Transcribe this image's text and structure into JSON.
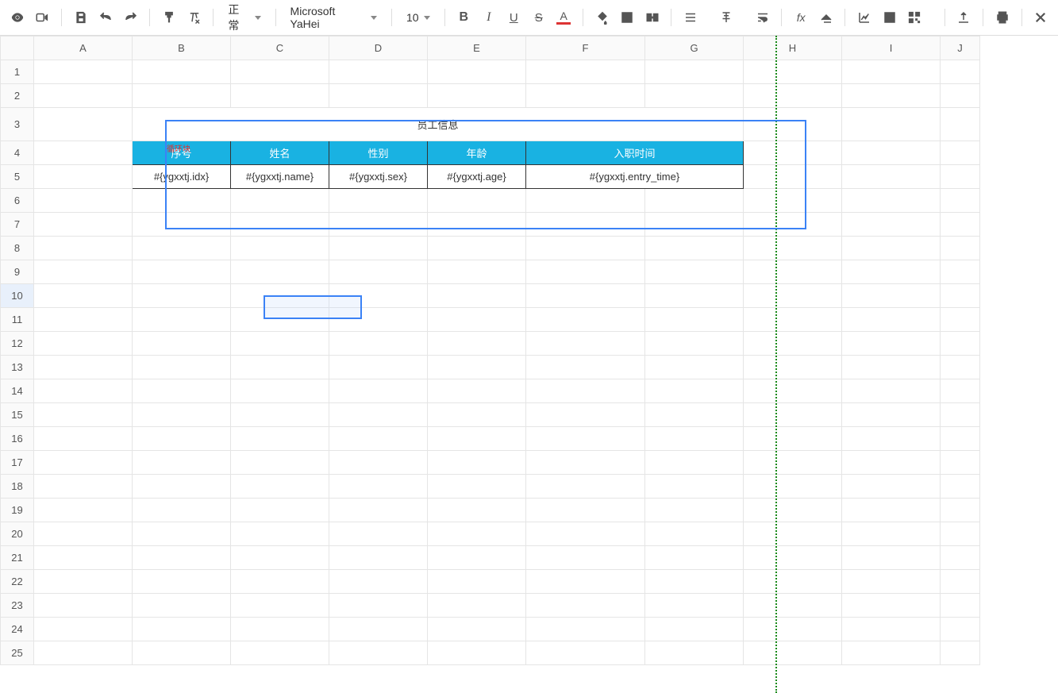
{
  "toolbar": {
    "format_label": "正常",
    "font_label": "Microsoft YaHei",
    "font_size": "10"
  },
  "sheet": {
    "columns": [
      "A",
      "B",
      "C",
      "D",
      "E",
      "F",
      "G",
      "H",
      "I",
      "J"
    ],
    "row_count": 25,
    "title": "员工信息",
    "loop_label": "循环块",
    "headers": [
      "序号",
      "姓名",
      "性别",
      "年龄",
      "入职时间"
    ],
    "data_row": [
      "#{ygxxtj.idx}",
      "#{ygxxtj.name}",
      "#{ygxxtj.sex}",
      "#{ygxxtj.age}",
      "#{ygxxtj.entry_time}"
    ],
    "active_cell": "C10",
    "selected_range": "B3:G6"
  }
}
